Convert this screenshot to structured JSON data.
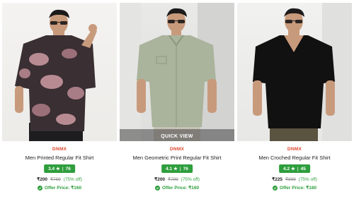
{
  "products": [
    {
      "brand": "DNMX",
      "name": "Men Printed Regular Fit Shirt",
      "rating": "3.4 ★",
      "reviews": "76",
      "price": "₹200",
      "mrp": "₹799",
      "discount": "(75% off)",
      "offer": "Offer Price: ₹160",
      "shirt_color": "#3a2f33",
      "print_color": "#b88b93"
    },
    {
      "brand": "DNMX",
      "name": "Men Geometric Print Regular Fit Shirt",
      "rating": "4.1 ★",
      "reviews": "76",
      "price": "₹200",
      "mrp": "₹799",
      "discount": "(75% off)",
      "offer": "Offer Price: ₹160",
      "shirt_color": "#aab39b",
      "quick_view": "QUICK VIEW"
    },
    {
      "brand": "DNMX",
      "name": "Men Croched Regular Fit Shirt",
      "rating": "4.2 ★",
      "reviews": "45",
      "price": "₹225",
      "mrp": "₹899",
      "discount": "(75% off)",
      "offer": "Offer Price: ₹180",
      "shirt_color": "#111111"
    }
  ],
  "colors": {
    "brand": "#e0442b",
    "rating_badge": "#2e9e3d",
    "offer": "#2e9e3d",
    "quick_view_overlay": "#464646"
  }
}
